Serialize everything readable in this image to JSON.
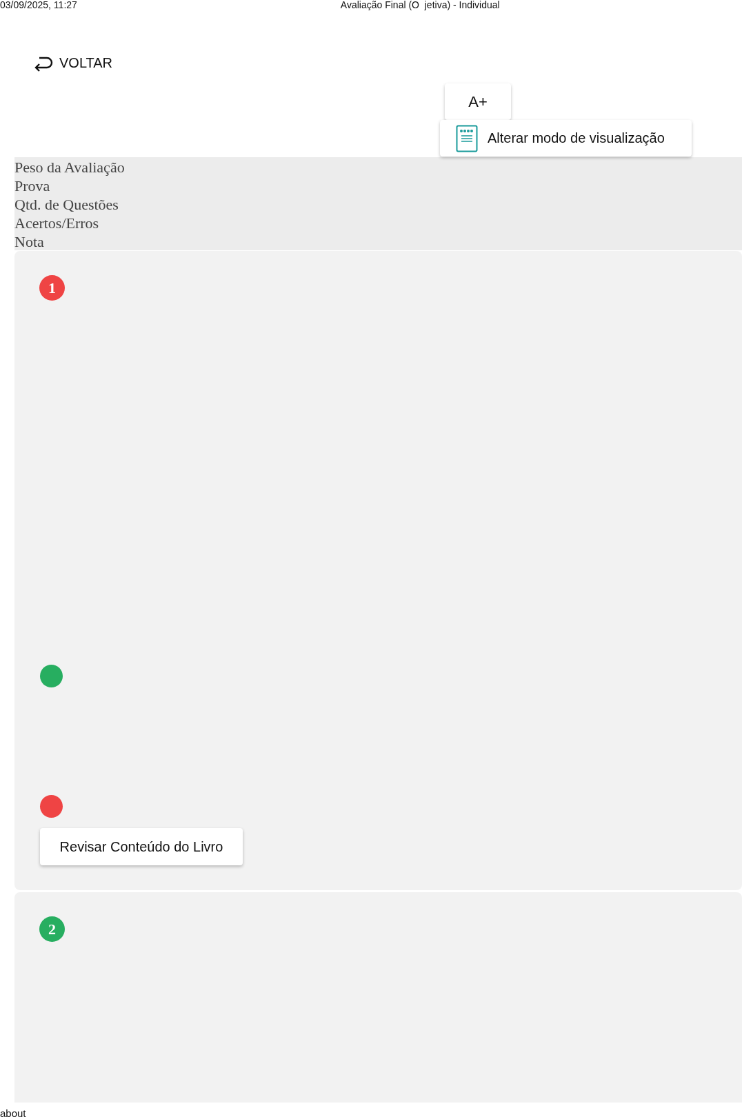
{
  "print_header": {
    "date": "03/09/2025, 11:27",
    "title": "Avaliação Final (O  jetiva) - Individual"
  },
  "back_link": {
    "label": "VOLTAR"
  },
  "toolbar": {
    "font_button": "A+",
    "view_button": "Alterar modo de visualização"
  },
  "summary": {
    "labels": [
      "Peso da Avaliação",
      "Prova",
      "Qtd. de Questões",
      "Acertos/Erros",
      "Nota"
    ]
  },
  "questions": [
    {
      "number": "1",
      "color": "#ef4444",
      "marks": [
        {
          "color": "#27ae60"
        },
        {
          "color": "#ef4444"
        }
      ],
      "review_button": "Revisar Conteúdo do Livro"
    },
    {
      "number": "2",
      "color": "#27ae60"
    }
  ],
  "print_footer": {
    "text": "about"
  }
}
